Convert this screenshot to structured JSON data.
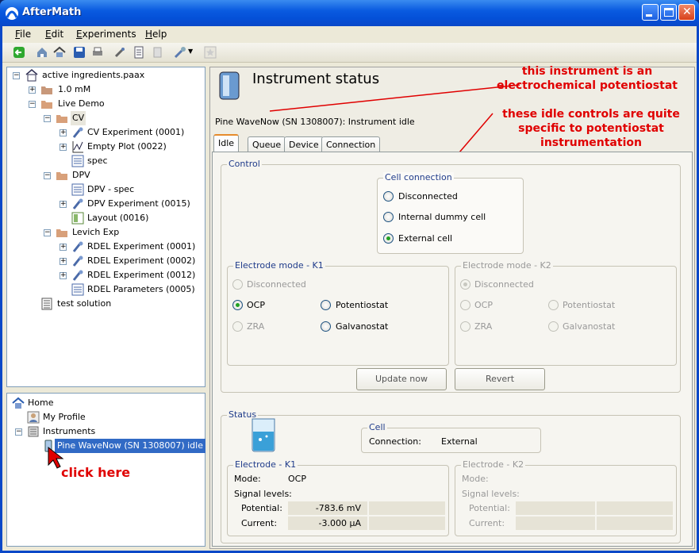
{
  "window": {
    "title": "AfterMath"
  },
  "menu": [
    "File",
    "Edit",
    "Experiments",
    "Help"
  ],
  "project_tree": {
    "root": "active ingredients.paax",
    "items": [
      "1.0 mM",
      "Live Demo",
      "CV",
      "CV Experiment (0001)",
      "Empty Plot (0022)",
      "spec",
      "DPV",
      "DPV - spec",
      "DPV Experiment (0015)",
      "Layout (0016)",
      "Levich Exp",
      "RDEL Experiment (0001)",
      "RDEL Experiment (0002)",
      "RDEL Experiment (0012)",
      "RDEL Parameters (0005)",
      "test solution"
    ]
  },
  "nav_tree": {
    "home": "Home",
    "profile": "My Profile",
    "instruments": "Instruments",
    "instrument": "Pine WaveNow (SN 1308007) idle"
  },
  "main": {
    "heading": "Instrument status",
    "status_line": "Pine WaveNow (SN 1308007): Instrument idle",
    "tabs": [
      "Idle",
      "Queue",
      "Device",
      "Connection"
    ],
    "control": {
      "title": "Control",
      "cell_connection": {
        "title": "Cell connection",
        "options": [
          "Disconnected",
          "Internal dummy cell",
          "External cell"
        ],
        "selected": "External cell"
      },
      "k1": {
        "title": "Electrode mode - K1",
        "options": [
          "Disconnected",
          "OCP",
          "Potentiostat",
          "ZRA",
          "Galvanostat"
        ],
        "selected": "OCP"
      },
      "k2": {
        "title": "Electrode mode - K2",
        "options": [
          "Disconnected",
          "OCP",
          "Potentiostat",
          "ZRA",
          "Galvanostat"
        ],
        "selected": "Disconnected"
      },
      "update_button": "Update now",
      "revert_button": "Revert"
    },
    "status": {
      "title": "Status",
      "cell": {
        "title": "Cell",
        "connection_label": "Connection:",
        "connection_value": "External"
      },
      "k1": {
        "title": "Electrode - K1",
        "mode_label": "Mode:",
        "mode_value": "OCP",
        "signal_label": "Signal levels:",
        "potential_label": "Potential:",
        "potential_value": "-783.6 mV",
        "current_label": "Current:",
        "current_value": "-3.000 µA"
      },
      "k2": {
        "title": "Electrode - K2",
        "mode_label": "Mode:",
        "signal_label": "Signal levels:",
        "potential_label": "Potential:",
        "current_label": "Current:"
      }
    }
  },
  "annotations": {
    "potentiostat": "this instrument is an electrochemical potentiostat",
    "idle_controls": "these idle controls are quite specific to potentiostat instrumentation",
    "click_here": "click here"
  },
  "colors": {
    "annotation": "#e00000",
    "selection": "#316ac5",
    "group_title": "#1f3b8a"
  }
}
